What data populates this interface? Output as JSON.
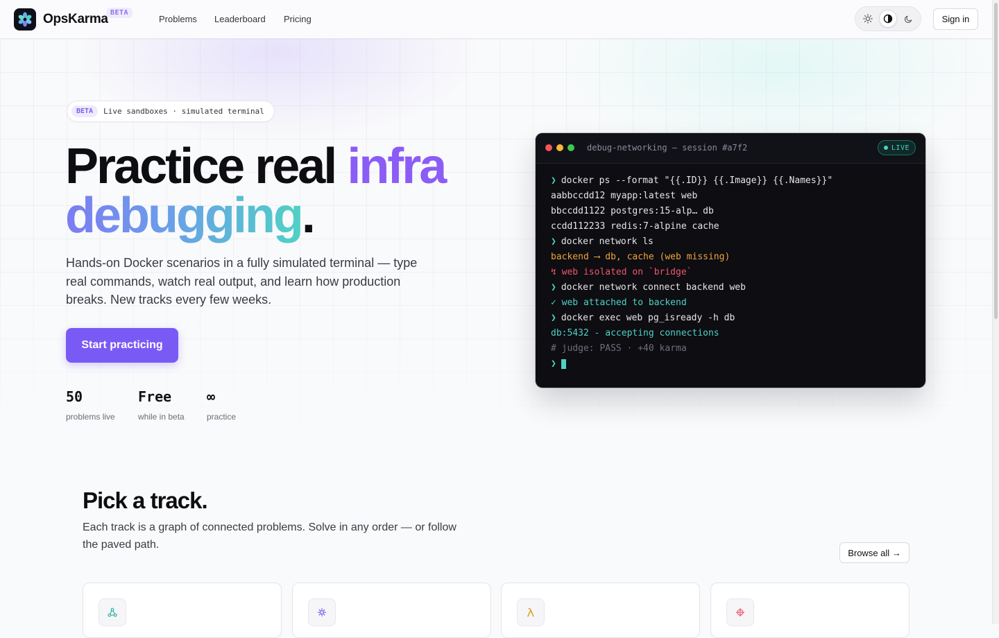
{
  "nav": {
    "brand": "OpsKarma",
    "badge": "BETA",
    "links": [
      "Problems",
      "Leaderboard",
      "Pricing"
    ],
    "theme_options": [
      "light",
      "system",
      "dark"
    ],
    "theme_selected": "system",
    "sign_in": "Sign in"
  },
  "hero": {
    "pill_tag": "BETA",
    "pill_text": "Live sandboxes · simulated terminal",
    "title_part1": "Practice real ",
    "title_highlight": "infra",
    "title_line2": "debugging",
    "title_dot": ".",
    "lead": "Hands-on Docker scenarios in a fully simulated terminal — type real commands, watch real output, and learn how production breaks. New tracks every few weeks.",
    "cta": "Start practicing",
    "stats": [
      {
        "value": "50",
        "label": "problems live"
      },
      {
        "value": "Free",
        "label": "while in beta"
      },
      {
        "value": "∞",
        "label": "practice"
      }
    ]
  },
  "terminal": {
    "title": "debug-networking — session #a7f2",
    "live_label": "LIVE",
    "prompt_symbol": "❯",
    "lines": [
      {
        "kind": "cmd",
        "text": "docker ps --format \"{{.ID}} {{.Image}} {{.Names}}\""
      },
      {
        "kind": "out",
        "text": "aabbccdd12 myapp:latest web"
      },
      {
        "kind": "out",
        "text": "bbccdd1122 postgres:15-alp… db"
      },
      {
        "kind": "out",
        "text": "ccdd112233 redis:7-alpine cache"
      },
      {
        "kind": "cmd",
        "text": "docker network ls"
      },
      {
        "kind": "warn",
        "text": "backend ⟶ db, cache (web missing)"
      },
      {
        "kind": "err",
        "text": "↯ web isolated on `bridge`"
      },
      {
        "kind": "cmd",
        "text": "docker network connect backend web"
      },
      {
        "kind": "ok",
        "text": "✓ web attached to backend"
      },
      {
        "kind": "cmd",
        "text": "docker exec web pg_isready -h db"
      },
      {
        "kind": "ok",
        "text": "db:5432 - accepting connections"
      },
      {
        "kind": "dim",
        "text": "# judge: PASS · +40 karma"
      }
    ]
  },
  "tracks": {
    "title": "Pick a track.",
    "subtitle": "Each track is a graph of connected problems. Solve in any order — or follow the paved path.",
    "browse": "Browse all →",
    "cards": [
      {
        "icon": "network-icon",
        "color": "#2bb3a3"
      },
      {
        "icon": "kubernetes-icon",
        "color": "#7c63e6"
      },
      {
        "icon": "lambda-icon",
        "color": "#e0a020"
      },
      {
        "icon": "crosshair-icon",
        "color": "#e85d6a"
      }
    ]
  }
}
